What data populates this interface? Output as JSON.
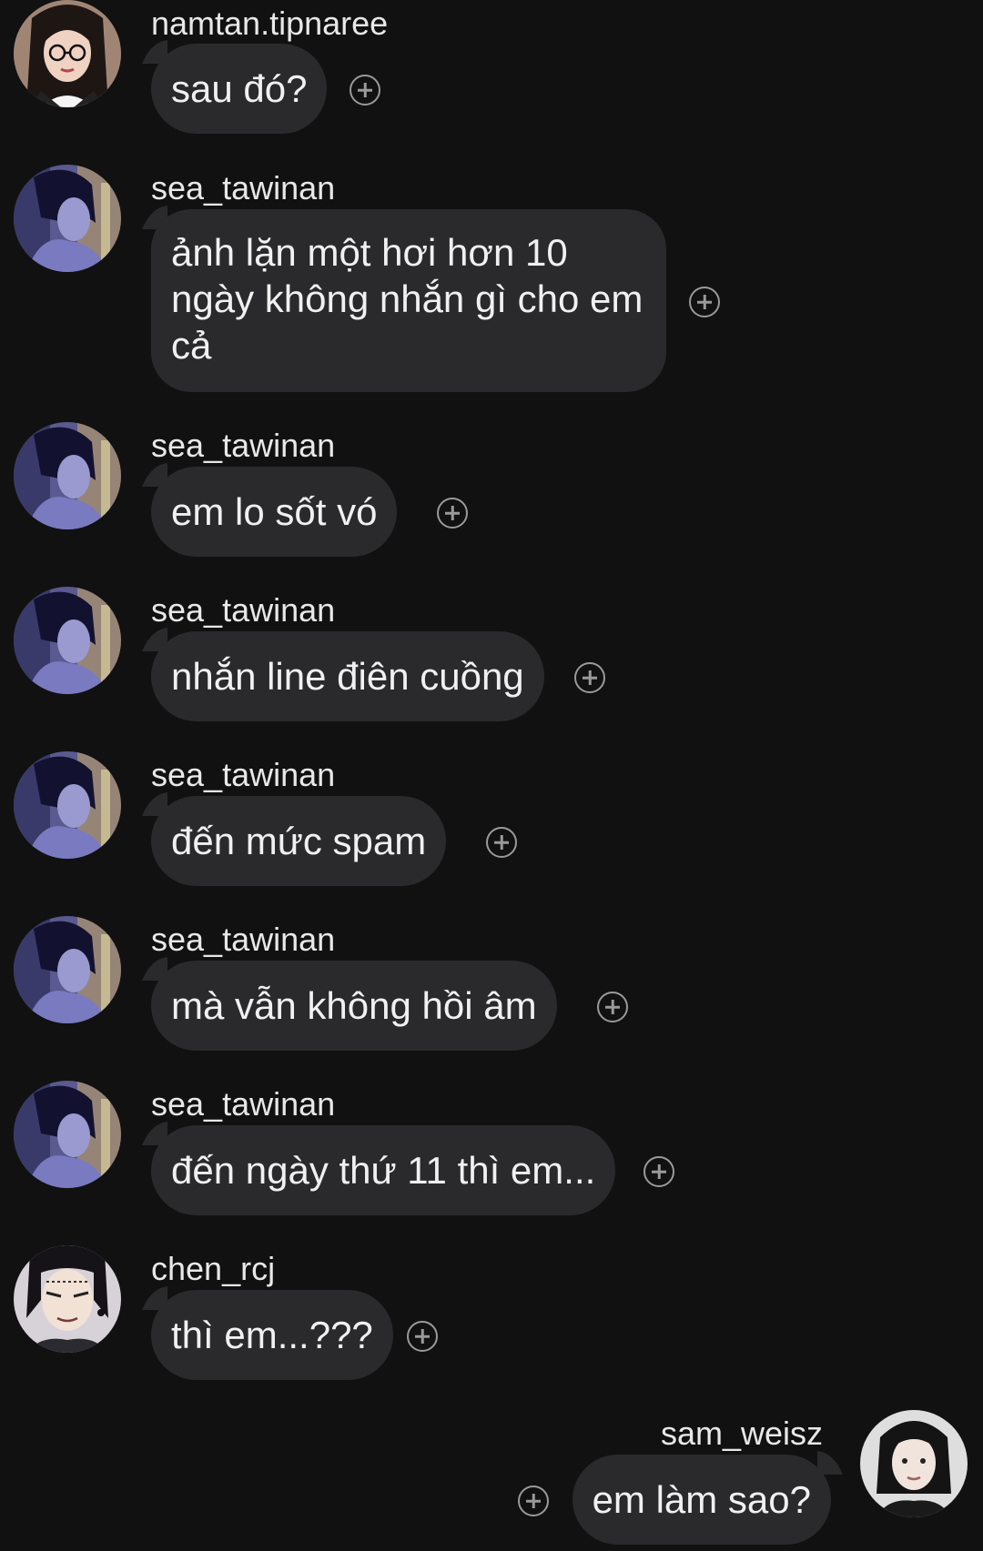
{
  "messages": [
    {
      "username": "namtan.tipnaree",
      "text": "sau đó?"
    },
    {
      "username": "sea_tawinan",
      "text": "ảnh lặn một hơi hơn 10 ngày không nhắn gì cho em cả"
    },
    {
      "username": "sea_tawinan",
      "text": "em lo sốt vó"
    },
    {
      "username": "sea_tawinan",
      "text": "nhắn line điên cuồng"
    },
    {
      "username": "sea_tawinan",
      "text": "đến mức spam"
    },
    {
      "username": "sea_tawinan",
      "text": "mà vẫn không hồi âm"
    },
    {
      "username": "sea_tawinan",
      "text": "đến ngày thứ 11 thì em..."
    },
    {
      "username": "chen_rcj",
      "text": "thì em...???"
    },
    {
      "username": "sam_weisz",
      "text": "em làm sao?"
    }
  ],
  "icons": {
    "react": "add-reaction-icon"
  },
  "colors": {
    "background": "#111112",
    "bubble": "#2a2a2c",
    "text": "#f0f0f0",
    "icon": "#9a9a9a"
  }
}
